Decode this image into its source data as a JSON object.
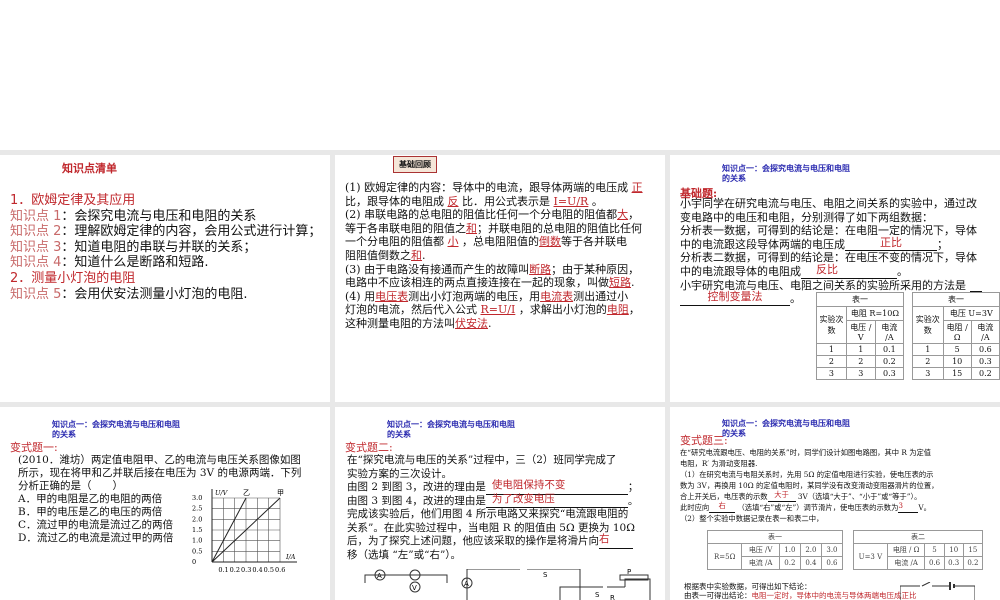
{
  "slide1": {
    "title": "知识点清单",
    "h1": "1．欧姆定律及其应用",
    "points": [
      {
        "label": "知识点 1",
        "text": "：会探究电流与电压和电阻的关系"
      },
      {
        "label": "知识点 2",
        "text": "：理解欧姆定律的内容，会用公式进行计算；"
      },
      {
        "label": "知识点 3",
        "text": "：知道电阻的串联与并联的关系；"
      },
      {
        "label": "知识点 4",
        "text": "：知道什么是断路和短路."
      }
    ],
    "h2": "2．测量小灯泡的电阻",
    "point5": {
      "label": "知识点 5",
      "text": "：会用伏安法测量小灯泡的电阻."
    }
  },
  "slide2": {
    "badge": "基础回顾",
    "a": [
      "正",
      "反",
      "I=U/R",
      "大",
      "和",
      "小",
      "倒数",
      "和",
      "断路",
      "短路",
      "电压表",
      "电流表",
      "R=U/I",
      "电阻",
      "伏安法"
    ],
    "t": [
      "(1) 欧姆定律的内容：导体中的电流，跟导体两端的电压成",
      "比，跟导体的电阻成",
      "比．用公式表示是",
      "。",
      "(2) 串联电路的总电阻的阻值比任何一个分电阻的阻值都",
      "，",
      "等于各串联电阻的阻值之",
      "；并联电阻的总电阻的阻值比任何",
      "一个分电阻的阻值都",
      "，总电阻阻值的",
      "等于各并联电",
      "阻阻值倒数之",
      ".",
      "(3) 由于电路没有接通而产生的故障叫",
      "；由于某种原因，",
      "电路中不应该相连的两点直接连接在一起的现象，叫做",
      "(4) 用",
      "测出小灯泡两端的电压，用",
      "测出通过小",
      "灯泡的电流，然后代入公式",
      "，求解出小灯泡的",
      "这种测量电阻的方法叫"
    ]
  },
  "header": {
    "kp1_line1": "知识点一：会探究电流与电压和电阻",
    "kp1_line2": "的关系"
  },
  "slide3": {
    "label": "基础题:",
    "lines": [
      "小宇同学在研究电流与电压、电阻之间关系的实验中，通过改",
      "变电路中的电压和电阻，分别测得了如下两组数据：",
      "分析表一数据，可得到的结论是：在电阻一定的情况下，导体",
      "中的电流跟这段导体两端的电压成",
      "分析表二数据，可得到的结论是：在电压不变的情况下，导体",
      "中的电流跟导体的电阻成",
      "小宇研究电流与电压、电阻之间关系的实验所采用的方法是"
    ],
    "answers": [
      "正比",
      "反比",
      "控制变量法"
    ],
    "table1": {
      "title": "表一",
      "col0": "实验次数",
      "cond": "电阻 R=10Ω",
      "h1": "电压 / V",
      "h2": "电流 /A",
      "rows": [
        [
          "1",
          "1",
          "0.1"
        ],
        [
          "2",
          "2",
          "0.2"
        ],
        [
          "3",
          "3",
          "0.3"
        ]
      ]
    },
    "table2": {
      "title": "表一",
      "col0": "实验次数",
      "cond": "电压 U=3V",
      "h1": "电阻 /Ω",
      "h2": "电流 /A",
      "rows": [
        [
          "1",
          "5",
          "0.6"
        ],
        [
          "2",
          "10",
          "0.3"
        ],
        [
          "3",
          "15",
          "0.2"
        ]
      ]
    }
  },
  "slide4": {
    "label": "变式题一:",
    "lines": [
      "(2010．潍坊）两定值电阻甲、乙的电流与电压关系图像如图",
      "所示，现在将甲和乙并联后接在电压为 3V 的电源两端．下列",
      "分析正确的是（　　）"
    ],
    "options": [
      "A．甲的电阻是乙的电阻的两倍",
      "B．甲的电压是乙的电压的两倍",
      "C．流过甲的电流是流过乙的两倍",
      "D．流过乙的电流是流过甲的两倍"
    ],
    "chart_data": {
      "type": "line",
      "xlabel": "I/A",
      "ylabel": "U/V",
      "xticks": [
        "0.1",
        "0.2",
        "0.3",
        "0.4",
        "0.5",
        "0.6"
      ],
      "yticks": [
        "0",
        "0.5",
        "1.0",
        "1.5",
        "2.0",
        "2.5",
        "3.0"
      ],
      "xlim": [
        0,
        0.6
      ],
      "ylim": [
        0,
        3
      ],
      "series": [
        {
          "name": "乙",
          "x": [
            0,
            0.3
          ],
          "y": [
            0,
            3
          ]
        },
        {
          "name": "甲",
          "x": [
            0,
            0.6
          ],
          "y": [
            0,
            3
          ]
        }
      ]
    }
  },
  "slide5": {
    "label": "变式题二:",
    "lines": [
      "在“探究电流与电压的关系”过程中，三（2）班同学完成了",
      "实验方案的三次设计。",
      "由图 2 到图 3，改进的理由是",
      "由图 3 到图 4，改进的理由是",
      "完成该实验后，他们用图 4 所示电路又来探究“电流跟电阻的",
      "关系”。在此实验过程中，当电阻 R 的阻值由 5Ω 更换为 10Ω",
      "后，为了探究上述问题，他应该采取的操作是将滑片向",
      "移（选填 “左”或“右”）。"
    ],
    "answers": [
      "使电阻保持不变",
      "为了改变电压",
      "右"
    ],
    "symbols": [
      "A",
      "V",
      "A",
      "S",
      "S",
      "P",
      "R"
    ]
  },
  "slide6": {
    "label": "变式题三:",
    "lines": [
      "在“研究电流跟电压、电阻的关系”时，同学们设计如图电路图，其中 R 为定值",
      "电阻，R′ 为滑动变阻器.",
      "（1）在研究电流与电阻关系时，先用 5Ω 的定值电阻进行实验，使电压表的示",
      "数为 3V，再换用 10Ω 的定值电阻时，某同学没有改变滑动变阻器滑片的位置，",
      "合上开关后，电压表的示数",
      "3V（选填“大于”、“小于”或“等于”）。",
      "此时应向",
      "（选填“右”或“左”）调节滑片，使电压表的示数为",
      "V。",
      "（2）整个实验中数据记录在表一和表二中，",
      "根据表中实验数据，可得出如下结论：",
      "由表一可得出结论："
    ],
    "answers": [
      "大于",
      "右",
      "3",
      "电阻一定时，导体中的电流与导体两端电压成正比"
    ],
    "table1": {
      "title": "表一",
      "cond": "R=5Ω",
      "r1": [
        "电压 /V",
        "1.0",
        "2.0",
        "3.0"
      ],
      "r2": [
        "电流 /A",
        "0.2",
        "0.4",
        "0.6"
      ]
    },
    "table2": {
      "title": "表二",
      "cond": "U=3 V",
      "r1": [
        "电阻 / Ω",
        "5",
        "10",
        "15"
      ],
      "r2": [
        "电流 /A",
        "0.6",
        "0.3",
        "0.2"
      ]
    }
  }
}
